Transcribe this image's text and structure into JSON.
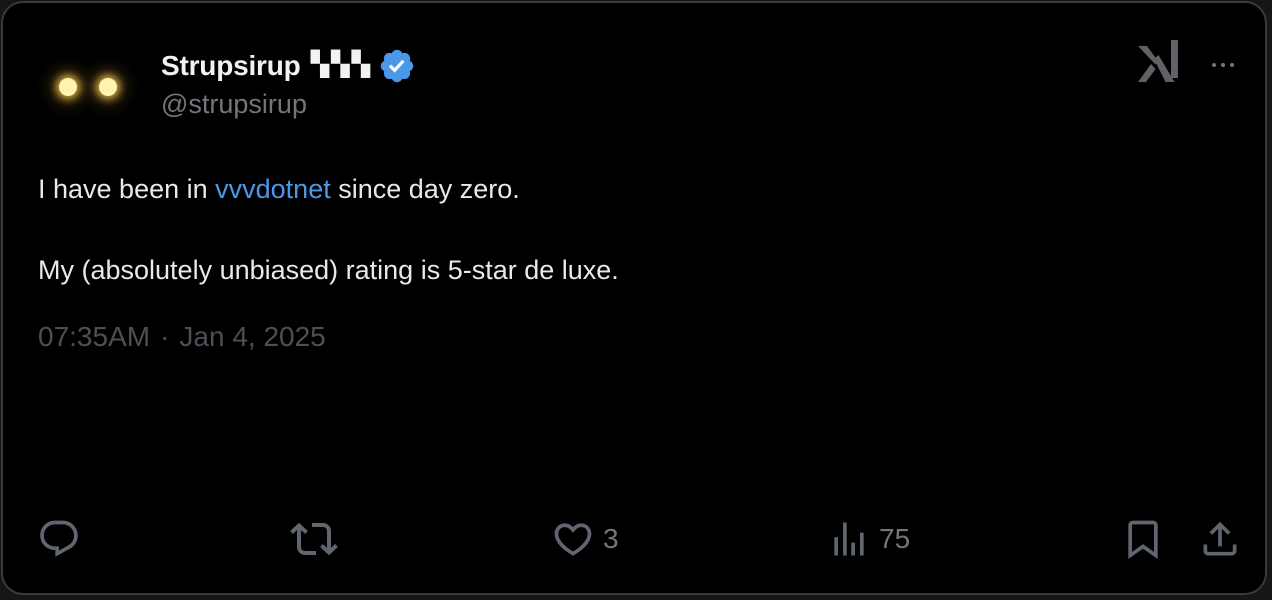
{
  "author": {
    "display_name": "Strupsirup",
    "name_badges": "▚▚▚",
    "handle": "@strupsirup",
    "verified": true
  },
  "tweet": {
    "line1_before": "I have been in ",
    "mention": "vvvdotnet",
    "line1_after": " since day zero.",
    "line2": "My (absolutely unbiased) rating is 5-star de luxe.",
    "time": "07:35AM",
    "separator": "·",
    "date": "Jan 4, 2025"
  },
  "actions": {
    "reply_count": "",
    "retweet_count": "",
    "like_count": "3",
    "views_count": "75"
  },
  "icons": {
    "avatar": "glowing-eyes-avatar",
    "verified": "verified-badge-icon",
    "brand": "x-logo-icon",
    "more": "more-options-icon",
    "reply": "reply-icon",
    "retweet": "retweet-icon",
    "like": "heart-icon",
    "views": "views-icon",
    "bookmark": "bookmark-icon",
    "share": "share-icon"
  },
  "colors": {
    "background": "#000000",
    "text": "#e7e9ea",
    "muted": "#71767b",
    "link": "#4a99e9",
    "verified": "#4a99e9"
  }
}
